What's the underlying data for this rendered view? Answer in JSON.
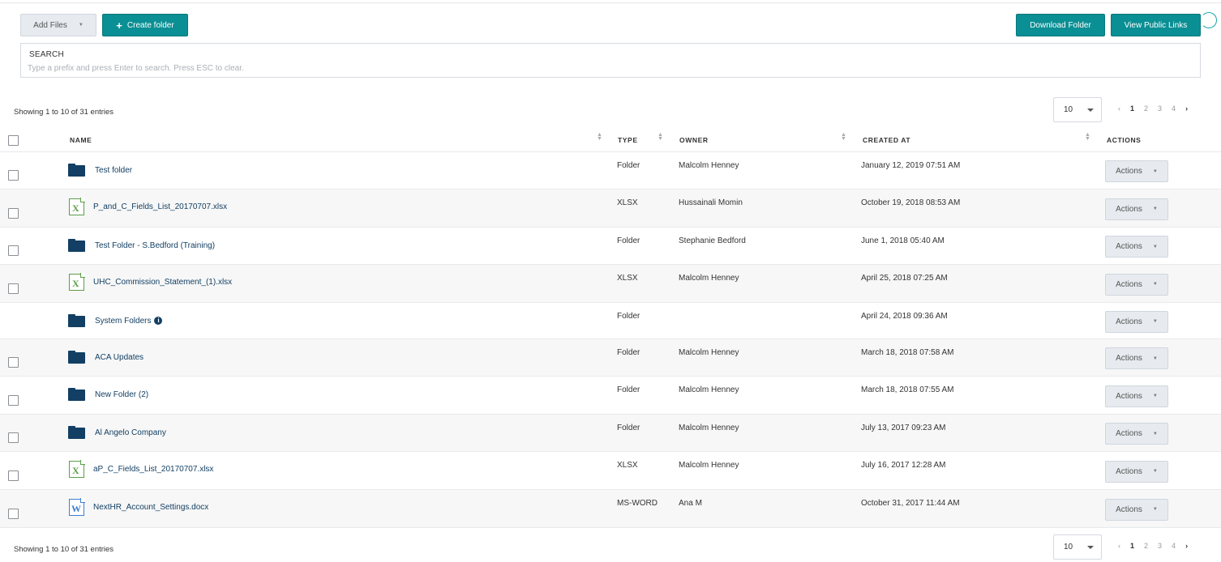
{
  "toolbar": {
    "add_files": "Add Files",
    "create_folder": "Create folder",
    "download_folder": "Download Folder",
    "view_public_links": "View Public Links"
  },
  "search": {
    "label": "SEARCH",
    "placeholder": "Type a prefix and press Enter to search. Press ESC to clear."
  },
  "pagination": {
    "info": "Showing 1 to 10 of 31 entries",
    "page_size": "10",
    "prev": "‹",
    "pages": [
      "1",
      "2",
      "3",
      "4"
    ],
    "current_page": "1",
    "next": "›"
  },
  "table": {
    "columns": {
      "name": "NAME",
      "type": "TYPE",
      "owner": "OWNER",
      "created_at": "CREATED AT",
      "actions": "ACTIONS"
    },
    "action_label": "Actions",
    "rows": [
      {
        "icon": "folder",
        "name": "Test folder",
        "type": "Folder",
        "owner": "Malcolm Henney",
        "created": "January 12, 2019 07:51 AM",
        "checkbox": true
      },
      {
        "icon": "excel",
        "name": "P_and_C_Fields_List_20170707.xlsx",
        "type": "XLSX",
        "owner": "Hussainali Momin",
        "created": "October 19, 2018 08:53 AM",
        "checkbox": true
      },
      {
        "icon": "folder",
        "name": "Test Folder - S.Bedford (Training)",
        "type": "Folder",
        "owner": "Stephanie Bedford",
        "created": "June 1, 2018 05:40 AM",
        "checkbox": true
      },
      {
        "icon": "excel",
        "name": "UHC_Commission_Statement_(1).xlsx",
        "type": "XLSX",
        "owner": "Malcolm Henney",
        "created": "April 25, 2018 07:25 AM",
        "checkbox": true
      },
      {
        "icon": "folder",
        "name": "System Folders",
        "type": "Folder",
        "owner": "",
        "created": "April 24, 2018 09:36 AM",
        "checkbox": false,
        "info": true
      },
      {
        "icon": "folder",
        "name": "ACA Updates",
        "type": "Folder",
        "owner": "Malcolm Henney",
        "created": "March 18, 2018 07:58 AM",
        "checkbox": true
      },
      {
        "icon": "folder",
        "name": "New Folder (2)",
        "type": "Folder",
        "owner": "Malcolm Henney",
        "created": "March 18, 2018 07:55 AM",
        "checkbox": true
      },
      {
        "icon": "folder",
        "name": "Al Angelo Company",
        "type": "Folder",
        "owner": "Malcolm Henney",
        "created": "July 13, 2017 09:23 AM",
        "checkbox": true
      },
      {
        "icon": "excel",
        "name": "aP_C_Fields_List_20170707.xlsx",
        "type": "XLSX",
        "owner": "Malcolm Henney",
        "created": "July 16, 2017 12:28 AM",
        "checkbox": true
      },
      {
        "icon": "word",
        "name": "NextHR_Account_Settings.docx",
        "type": "MS-WORD",
        "owner": "Ana M",
        "created": "October 31, 2017 11:44 AM",
        "checkbox": true
      }
    ]
  },
  "colors": {
    "accent": "#0a8f94",
    "folder": "#123f63",
    "excel": "#5c9e4b",
    "word": "#3c7fd0"
  }
}
